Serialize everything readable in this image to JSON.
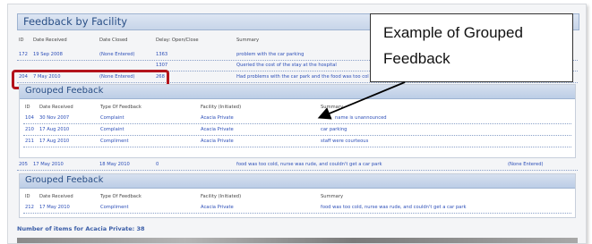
{
  "title": "Feedback by Facility",
  "main_table": {
    "headers": [
      "ID",
      "Date Received",
      "Date Closed",
      "Delay: Open/Close",
      "Summary"
    ],
    "rows": [
      {
        "id": "172",
        "received": "19 Sep 2008",
        "closed": "(None Entered)",
        "delay": "1363",
        "summary": "problem with the car parking"
      },
      {
        "id": "",
        "received": "",
        "closed": "",
        "delay": "1307",
        "summary": "Queried the cost of the stay at the hospital"
      },
      {
        "id": "204",
        "received": "7 May 2010",
        "closed": "(None Entered)",
        "delay": "268",
        "summary": "Had problems with the car park and the food was too col"
      }
    ]
  },
  "group1": {
    "title": "Grouped Feeback",
    "headers": [
      "ID",
      "Date Received",
      "Type Of Feedback",
      "Facility (Initiated)",
      "Summary"
    ],
    "rows": [
      {
        "id": "104",
        "received": "30 Nov 2007",
        "type": "Complaint",
        "facility": "Acacia Private",
        "summary": "name is unannounced"
      },
      {
        "id": "210",
        "received": "17 Aug 2010",
        "type": "Complaint",
        "facility": "Acacia Private",
        "summary": "car parking"
      },
      {
        "id": "211",
        "received": "17 Aug 2010",
        "type": "Compliment",
        "facility": "Acacia Private",
        "summary": "staff were courteous"
      }
    ]
  },
  "middle_row": {
    "id": "205",
    "received": "17 May 2010",
    "closed": "18 May 2010",
    "delay": "0",
    "summary": "food was too cold, nurse was rude, and couldn't get a car park",
    "extra": "(None Entered)"
  },
  "group2": {
    "title": "Grouped Feeback",
    "headers": [
      "ID",
      "Date Received",
      "Type Of Feedback",
      "Facility (Initiated)",
      "Summary"
    ],
    "rows": [
      {
        "id": "212",
        "received": "17 May 2010",
        "type": "Compliment",
        "facility": "Acacia Private",
        "summary": "food was too cold, nurse was rude, and couldn't get a car park"
      }
    ]
  },
  "count_text": "Number of items for Acacia Private: 38",
  "callout": {
    "line1": "Example of Grouped",
    "line2": "Feedback"
  },
  "colors": {
    "accent": "#2d4fb8",
    "highlight": "#b3141c",
    "title": "#2a4f86"
  }
}
